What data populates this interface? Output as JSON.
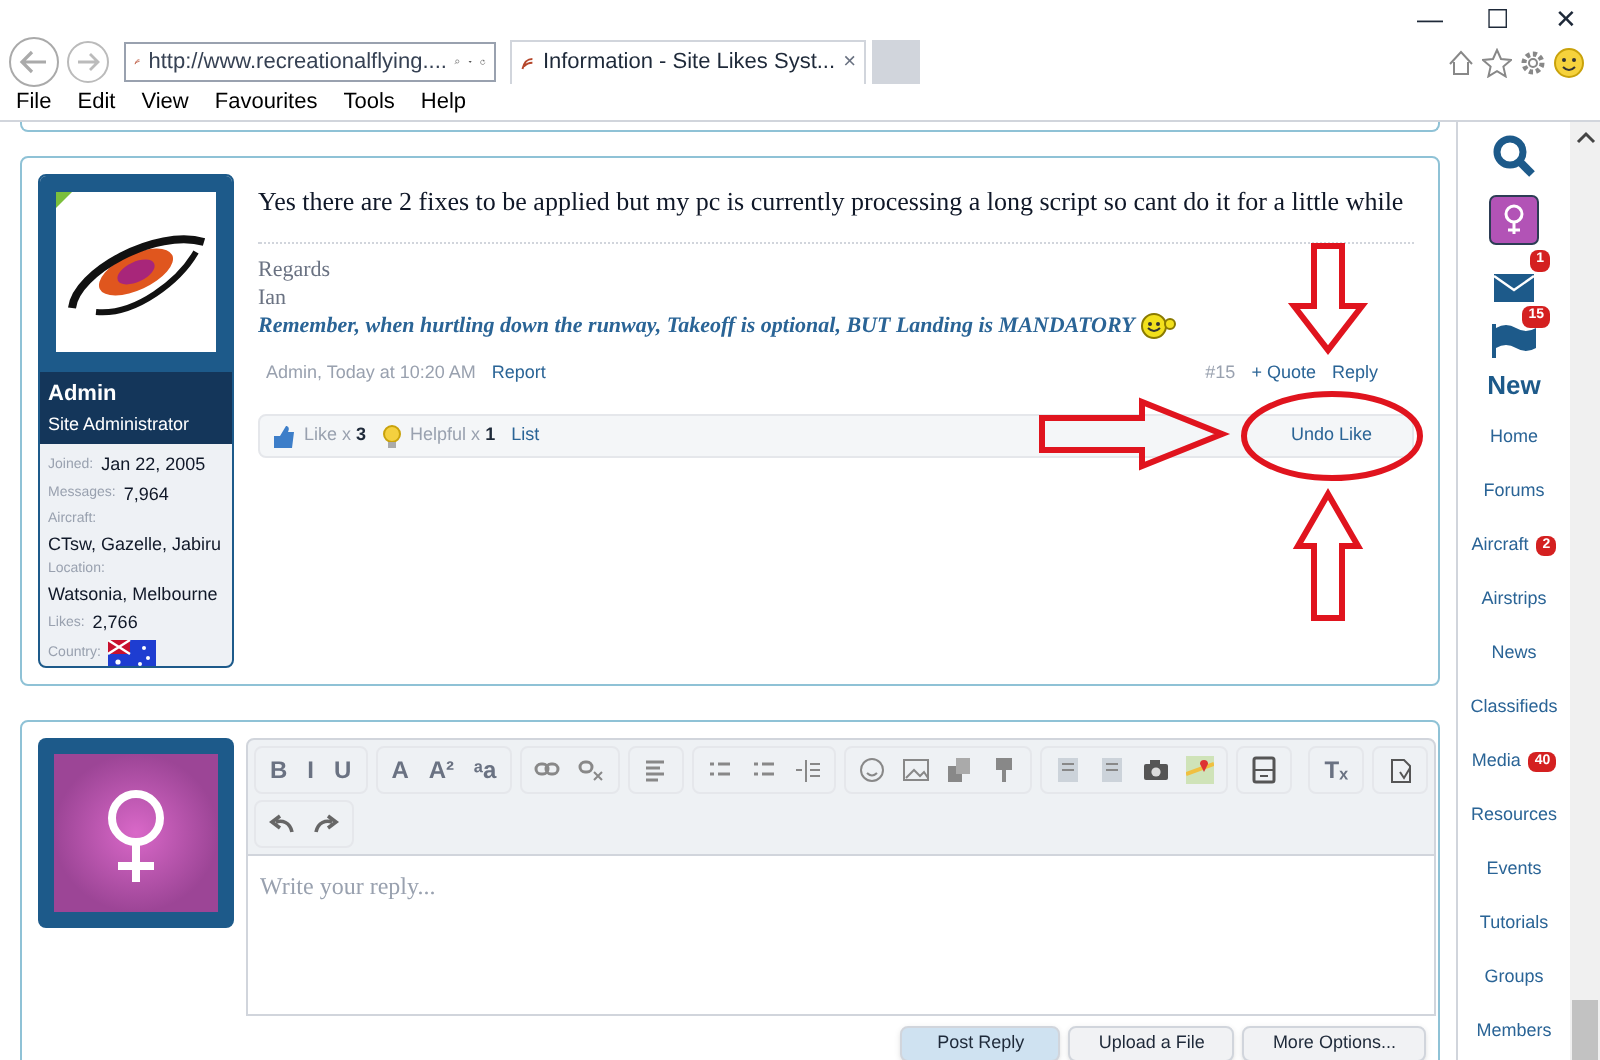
{
  "browser": {
    "address": "http://www.recreationalflying....",
    "tab_title": "Information - Site Likes Syst...",
    "tab_close": "×",
    "window_controls": [
      "—",
      "☐",
      "✕"
    ],
    "menu": [
      "File",
      "Edit",
      "View",
      "Favourites",
      "Tools",
      "Help"
    ]
  },
  "post": {
    "author": {
      "name": "Admin",
      "title": "Site Administrator",
      "stats": [
        {
          "label": "Joined:",
          "value": "Jan 22, 2005",
          "inline": true
        },
        {
          "label": "Messages:",
          "value": "7,964",
          "inline": true
        },
        {
          "label": "Aircraft:",
          "value": "CTsw, Gazelle, Jabiru",
          "inline": false
        },
        {
          "label": "Location:",
          "value": "Watsonia, Melbourne",
          "inline": false
        },
        {
          "label": "Likes:",
          "value": "2,766",
          "inline": true
        },
        {
          "label": "Country:",
          "kind": "flag",
          "inline": true
        }
      ]
    },
    "message": "Yes there are 2 fixes to be applied but my pc is currently processing a long script so cant do it for a little while",
    "signature": [
      "Regards",
      "Ian"
    ],
    "motto": "Remember, when hurtling down the runway, Takeoff is optional, BUT Landing is MANDATORY",
    "meta": "Admin, Today at 10:20 AM",
    "report": "Report",
    "number": "#15",
    "quote": "+ Quote",
    "reply": "Reply",
    "likes": {
      "like": "Like x",
      "like_count": "3",
      "helpful": "Helpful x",
      "helpful_count": "1",
      "list": "List"
    },
    "undo": "Undo Like"
  },
  "editor": {
    "toolbar": [
      [
        {
          "kind": "text",
          "glyph": "B"
        },
        {
          "kind": "text",
          "glyph": "I"
        },
        {
          "kind": "text",
          "glyph": "U"
        }
      ],
      [
        {
          "kind": "text",
          "glyph": "A"
        },
        {
          "kind": "text",
          "glyph": "A²"
        },
        {
          "kind": "text",
          "glyph": "ᵃa"
        }
      ],
      [
        {
          "kind": "link"
        },
        {
          "kind": "unlink"
        }
      ],
      [
        {
          "kind": "align"
        }
      ],
      [
        {
          "kind": "list"
        },
        {
          "kind": "list"
        },
        {
          "kind": "indent"
        }
      ],
      [
        {
          "kind": "smiley"
        },
        {
          "kind": "image"
        },
        {
          "kind": "copy"
        },
        {
          "kind": "pin"
        }
      ],
      [
        {
          "kind": "doc"
        },
        {
          "kind": "doc"
        },
        {
          "kind": "camera"
        },
        {
          "kind": "map"
        }
      ],
      [
        {
          "kind": "save"
        }
      ],
      [
        {
          "kind": "text",
          "glyph": "Tₓ"
        }
      ],
      [
        {
          "kind": "paste"
        }
      ]
    ],
    "toolbar_row2": [
      [
        {
          "kind": "undo"
        },
        {
          "kind": "redo"
        }
      ]
    ],
    "placeholder": "Write your reply...",
    "buttons": [
      {
        "label": "Post Reply",
        "primary": true
      },
      {
        "label": "Upload a File",
        "primary": false
      },
      {
        "label": "More Options...",
        "primary": false
      }
    ]
  },
  "sidebar": {
    "new": "New",
    "alerts": [
      {
        "kind": "mail",
        "count": "1"
      },
      {
        "kind": "flag",
        "count": "15"
      }
    ],
    "items": [
      {
        "label": "Home"
      },
      {
        "label": "Forums"
      },
      {
        "label": "Aircraft",
        "badge": "2"
      },
      {
        "label": "Airstrips"
      },
      {
        "label": "News"
      },
      {
        "label": "Classifieds"
      },
      {
        "label": "Media",
        "badge": "40"
      },
      {
        "label": "Resources"
      },
      {
        "label": "Events"
      },
      {
        "label": "Tutorials"
      },
      {
        "label": "Groups"
      },
      {
        "label": "Members"
      }
    ]
  }
}
